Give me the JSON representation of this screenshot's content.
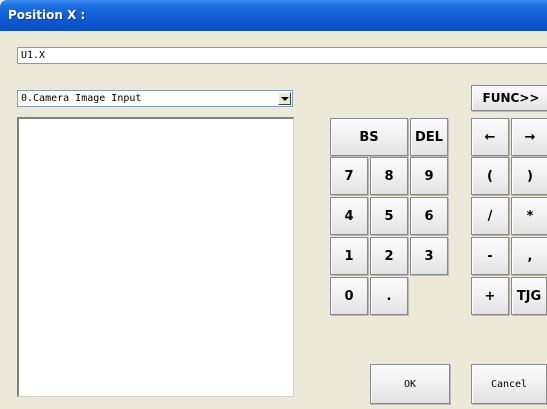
{
  "window": {
    "title": "Position X :"
  },
  "expression": {
    "value": "U1.X"
  },
  "source_select": {
    "selected": "0.Camera Image Input"
  },
  "keypad": {
    "bs": "BS",
    "del": "DEL",
    "k7": "7",
    "k8": "8",
    "k9": "9",
    "k4": "4",
    "k5": "5",
    "k6": "6",
    "k1": "1",
    "k2": "2",
    "k3": "3",
    "k0": "0",
    "dot": "."
  },
  "operators": {
    "func": "FUNC>>",
    "left": "←",
    "right": "→",
    "lparen": "(",
    "rparen": ")",
    "divide": "/",
    "multiply": "*",
    "minus": "-",
    "comma": ",",
    "plus": "+",
    "tjg": "TJG"
  },
  "actions": {
    "ok": "OK",
    "cancel": "Cancel"
  }
}
